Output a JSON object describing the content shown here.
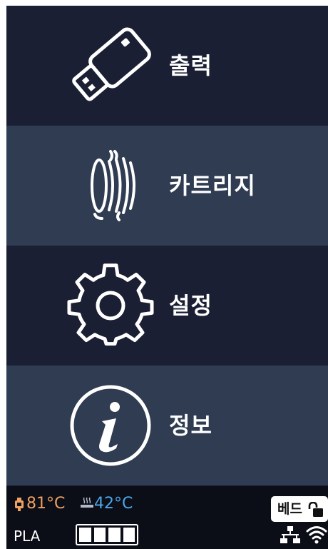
{
  "menu": {
    "items": [
      {
        "label": "출력",
        "icon": "usb-drive-icon"
      },
      {
        "label": "카트리지",
        "icon": "filament-spool-icon"
      },
      {
        "label": "설정",
        "icon": "gear-icon"
      },
      {
        "label": "정보",
        "icon": "info-icon"
      }
    ]
  },
  "status": {
    "nozzle_temp": "81°C",
    "bed_temp": "42°C",
    "bed_lock_label": "베드",
    "material": "PLA",
    "filament_level": 1.0
  },
  "colors": {
    "menu_dark": "#1b1f33",
    "menu_light": "#2f3c51",
    "status_bar": "#0b0d17",
    "nozzle_temp": "#f0a062",
    "bed_temp": "#4aa8e8"
  }
}
